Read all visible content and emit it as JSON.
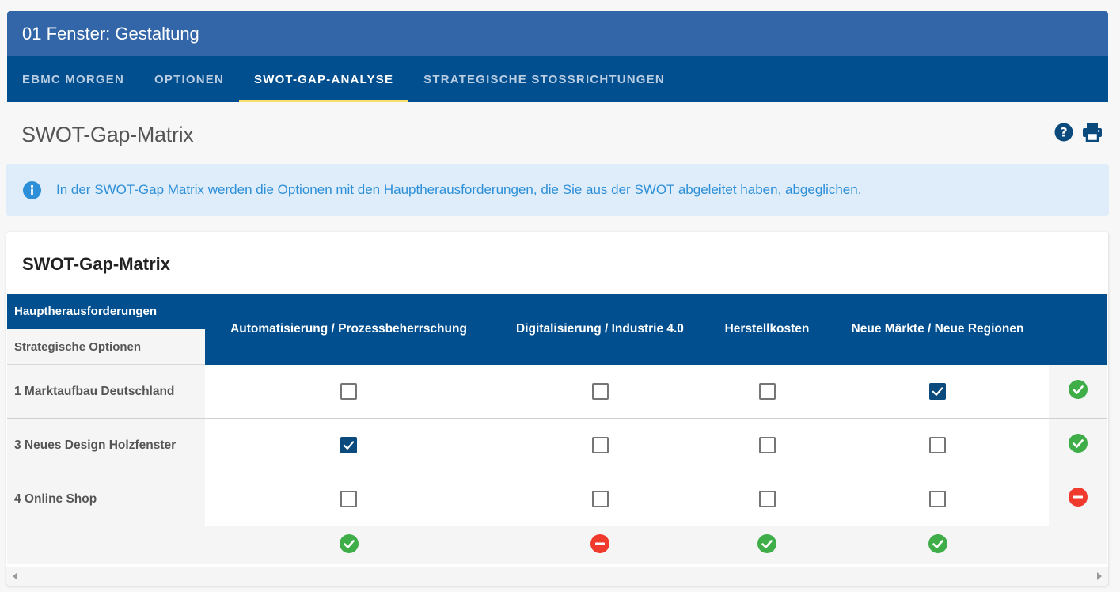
{
  "header": {
    "title": "01 Fenster: Gestaltung",
    "tabs": [
      {
        "label": "EBMC MORGEN",
        "active": false
      },
      {
        "label": "OPTIONEN",
        "active": false
      },
      {
        "label": "SWOT-GAP-ANALYSE",
        "active": true
      },
      {
        "label": "STRATEGISCHE STOSSRICHTUNGEN",
        "active": false
      }
    ]
  },
  "page": {
    "title": "SWOT-Gap-Matrix",
    "icons": [
      "help-icon",
      "print-icon"
    ]
  },
  "info": {
    "text": "In der SWOT-Gap Matrix werden die Optionen mit den Hauptherausforderungen, die Sie aus der SWOT abgeleitet haben, abgeglichen."
  },
  "matrix": {
    "title": "SWOT-Gap-Matrix",
    "corner_top": "Hauptherausforderungen",
    "corner_bottom": "Strategische Optionen",
    "columns": [
      "Automatisierung / Prozessbeherrschung",
      "Digitalisierung / Industrie 4.0",
      "Herstellkosten",
      "Neue Märkte / Neue Regionen"
    ],
    "rows": [
      {
        "label": "1 Marktaufbau Deutschland",
        "checks": [
          false,
          false,
          false,
          true
        ],
        "status": "ok"
      },
      {
        "label": "3 Neues Design Holzfenster",
        "checks": [
          true,
          false,
          false,
          false
        ],
        "status": "ok"
      },
      {
        "label": "4 Online Shop",
        "checks": [
          false,
          false,
          false,
          false
        ],
        "status": "missing"
      }
    ],
    "column_status": [
      "ok",
      "missing",
      "ok",
      "ok"
    ]
  },
  "colors": {
    "ok": "#3fae49",
    "missing": "#f03a2e",
    "primary": "#024f8f",
    "title_bar": "#3366a8"
  }
}
